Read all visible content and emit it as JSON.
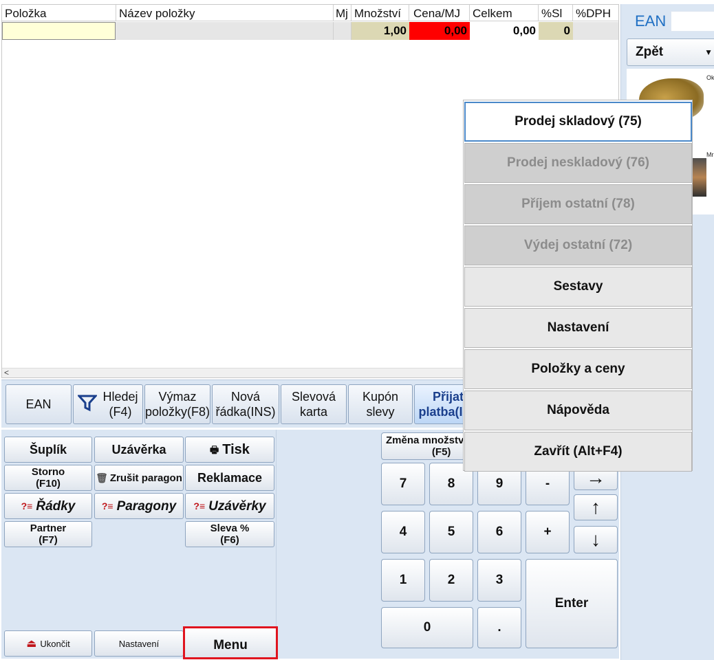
{
  "grid": {
    "columns": [
      "Položka",
      "Název položky",
      "Mj",
      "Množství",
      "Cena/MJ",
      "Celkem",
      "%Sl",
      "%DPH"
    ],
    "row": {
      "quantity": "1,00",
      "price": "0,00",
      "total": "0,00",
      "discount": "0"
    },
    "scroll_left": "<"
  },
  "toolbar": {
    "ean": "EAN",
    "search_line1": "Hledej",
    "search_line2": "(F4)",
    "delete_line1": "Výmaz",
    "delete_line2": "položky(F8)",
    "new_line1": "Nová",
    "new_line2": "řádka(INS)",
    "discount_card_line1": "Slevová",
    "discount_card_line2": "karta",
    "coupon_line1": "Kupón",
    "coupon_line2": "slevy",
    "payment_line1": "Přijat",
    "payment_line2": "platba(I"
  },
  "left": {
    "drawer": "Šuplík",
    "closing": "Uzávěrka",
    "print": "Tisk",
    "storno_line1": "Storno",
    "storno_line2": "(F10)",
    "cancel_receipt": "Zrušit paragon",
    "claims": "Reklamace",
    "rows": "Řádky",
    "receipts": "Paragony",
    "closings": "Uzávěrky",
    "partner_line1": "Partner",
    "partner_line2": "(F7)",
    "discount_line1": "Sleva %",
    "discount_line2": "(F6)",
    "exit": "Ukončit",
    "settings": "Nastavení",
    "menu": "Menu"
  },
  "numpad": {
    "qty_change_line1": "Změna množstv",
    "qty_change_line2": "(F5)",
    "k7": "7",
    "k8": "8",
    "k9": "9",
    "minus": "-",
    "k4": "4",
    "k5": "5",
    "k6": "6",
    "plus": "+",
    "k1": "1",
    "k2": "2",
    "k3": "3",
    "k0": "0",
    "dot": ".",
    "enter": "Enter",
    "arrow_right": "→",
    "arrow_up": "↑",
    "arrow_down": "↓"
  },
  "right_panel": {
    "ean_label": "EAN",
    "back": "Zpět",
    "prod1_label": "Ok",
    "prod2_label": "Mr"
  },
  "dropdown": {
    "items": [
      {
        "label": "Prodej skladový (75)",
        "state": "selected"
      },
      {
        "label": "Prodej neskladový (76)",
        "state": "disabled"
      },
      {
        "label": "Příjem ostatní (78)",
        "state": "disabled"
      },
      {
        "label": "Výdej ostatní (72)",
        "state": "disabled"
      },
      {
        "label": "Sestavy",
        "state": "enabled"
      },
      {
        "label": "Nastavení",
        "state": "enabled"
      },
      {
        "label": "Položky a ceny",
        "state": "enabled"
      },
      {
        "label": "Nápověda",
        "state": "enabled"
      },
      {
        "label": "Zavřít (Alt+F4)",
        "state": "enabled"
      }
    ]
  },
  "colors": {
    "price_cell": "#ff0000",
    "qty_cell": "#dcd8b4",
    "item_code_cell": "#ffffd8",
    "ean_label": "#1f6fc3",
    "menu_highlight": "#e0141e"
  }
}
